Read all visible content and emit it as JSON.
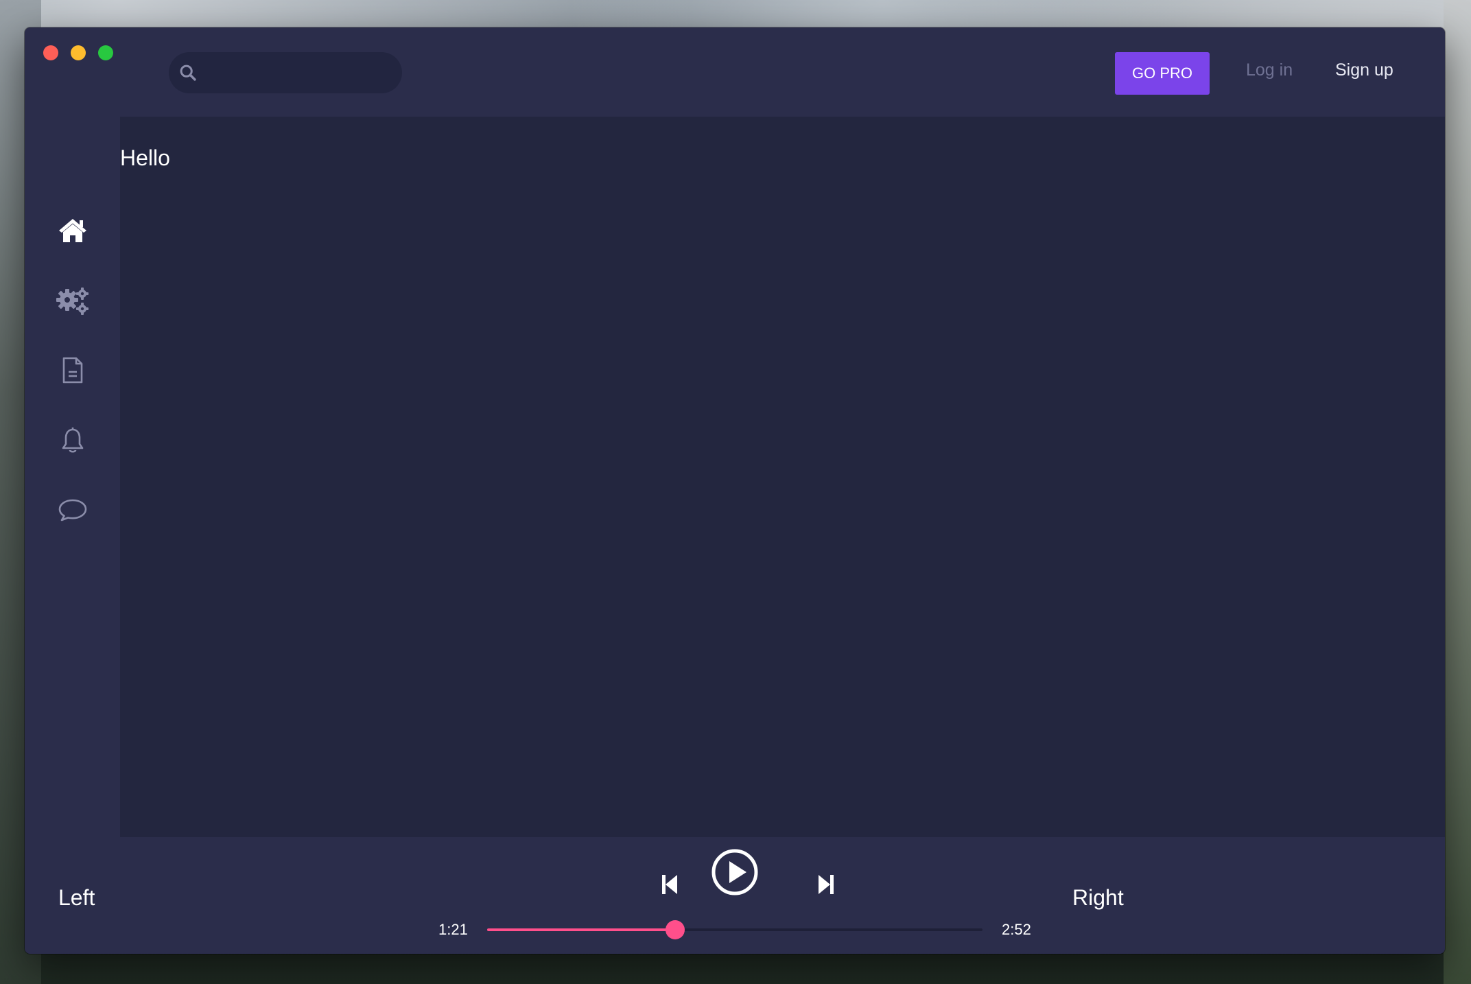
{
  "header": {
    "search": {
      "value": "",
      "placeholder": ""
    },
    "go_pro_label": "GO PRO",
    "login_label": "Log in",
    "signup_label": "Sign up"
  },
  "sidebar": {
    "items": [
      {
        "icon": "home-icon",
        "active": true
      },
      {
        "icon": "settings-gears-icon",
        "active": false
      },
      {
        "icon": "document-icon",
        "active": false
      },
      {
        "icon": "bell-icon",
        "active": false
      },
      {
        "icon": "chat-bubble-icon",
        "active": false
      }
    ]
  },
  "main": {
    "greeting": "Hello"
  },
  "player": {
    "left_label": "Left",
    "right_label": "Right",
    "current_time": "1:21",
    "total_time": "2:52",
    "progress": 0.38
  },
  "colors": {
    "accent_purple": "#7b44ea",
    "progress_pink": "#ff4f8b",
    "panel_bg": "#2b2d4b",
    "content_bg": "#23263f",
    "icon_active": "#ffffff",
    "icon_inactive": "#8b8daa"
  }
}
